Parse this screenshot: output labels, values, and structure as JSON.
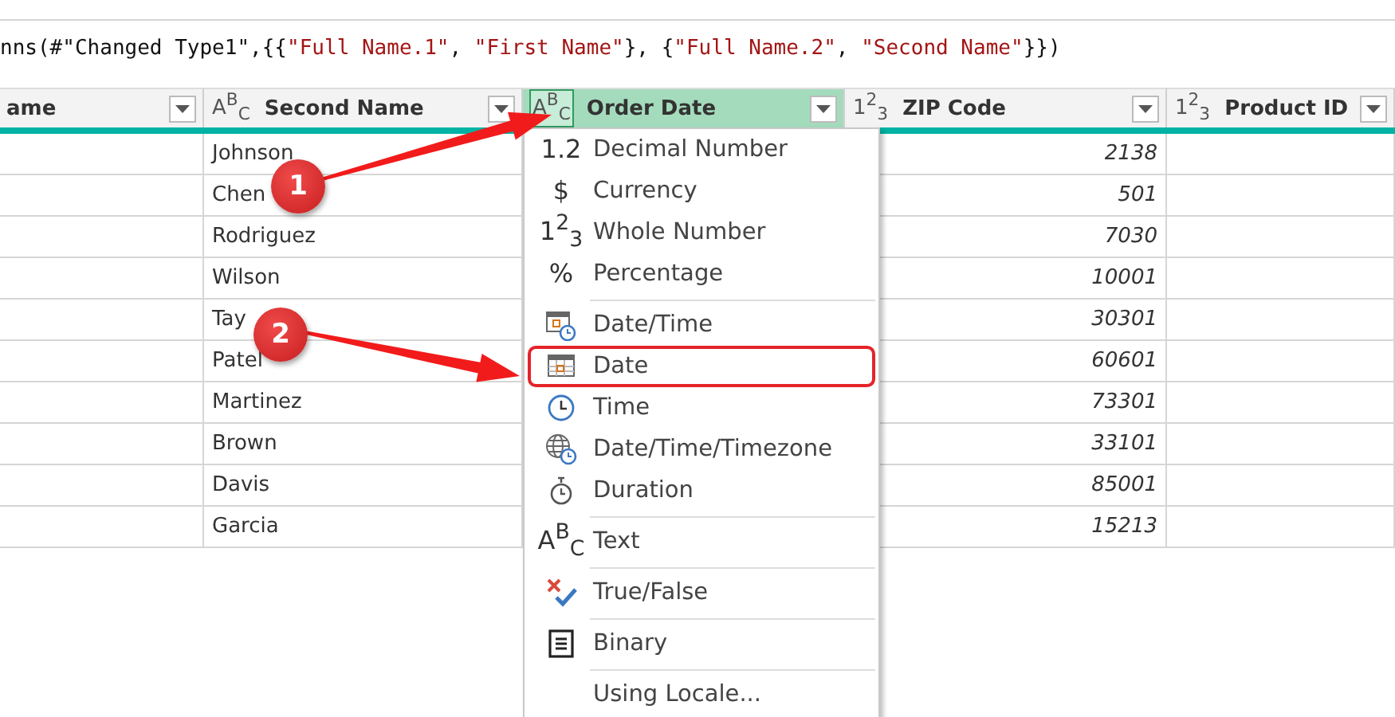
{
  "formula_bar": {
    "segments": [
      {
        "kind": "code",
        "text": "nns(#\"Changed Type1\",{{"
      },
      {
        "kind": "string",
        "text": "\"Full Name.1\""
      },
      {
        "kind": "code",
        "text": ", "
      },
      {
        "kind": "string",
        "text": "\"First Name\""
      },
      {
        "kind": "code",
        "text": "}, {"
      },
      {
        "kind": "string",
        "text": "\"Full Name.2\""
      },
      {
        "kind": "code",
        "text": ", "
      },
      {
        "kind": "string",
        "text": "\"Second Name\""
      },
      {
        "kind": "code",
        "text": "}})"
      }
    ]
  },
  "table": {
    "columns": [
      {
        "label": "ame",
        "selected": false
      },
      {
        "kind": "text",
        "type_icon": "A$^{B}$$_{C}$",
        "label": "Second Name",
        "selected": false
      },
      {
        "kind": "text",
        "type_icon": "A$^{B}$$_{C}$",
        "label": "Order Date",
        "selected": true
      },
      {
        "kind": "number",
        "type_icon": "1$^{2}$$_{3}$",
        "label": "ZIP Code",
        "selected": false
      },
      {
        "kind": "number",
        "type_icon": "1$^{2}$$_{3}$",
        "label": "Product ID",
        "selected": false
      }
    ],
    "rows": [
      {
        "second_name": "Johnson",
        "zip_code": "2138"
      },
      {
        "second_name": "Chen",
        "zip_code": "501"
      },
      {
        "second_name": "Rodriguez",
        "zip_code": "7030"
      },
      {
        "second_name": "Wilson",
        "zip_code": "10001"
      },
      {
        "second_name": "Tay",
        "zip_code": "30301"
      },
      {
        "second_name": "Patel",
        "zip_code": "60601"
      },
      {
        "second_name": "Martinez",
        "zip_code": "73301"
      },
      {
        "second_name": "Brown",
        "zip_code": "33101"
      },
      {
        "second_name": "Davis",
        "zip_code": "85001"
      },
      {
        "second_name": "Garcia",
        "zip_code": "15213"
      }
    ]
  },
  "type_menu": {
    "groups": [
      {
        "items": [
          {
            "kind": "glyph",
            "icon": "1.2",
            "label": "Decimal Number",
            "highlighted": false
          },
          {
            "kind": "glyph",
            "icon": "$",
            "label": "Currency",
            "highlighted": false
          },
          {
            "kind": "glyph",
            "icon": "1$^{2}$$_{3}$",
            "label": "Whole Number",
            "highlighted": false
          },
          {
            "kind": "glyph",
            "icon": "%",
            "label": "Percentage",
            "highlighted": false
          }
        ]
      },
      {
        "items": [
          {
            "kind": "datetime",
            "label": "Date/Time",
            "highlighted": false
          },
          {
            "kind": "date",
            "label": "Date",
            "highlighted": true
          },
          {
            "kind": "time",
            "label": "Time",
            "highlighted": false
          },
          {
            "kind": "timezone",
            "label": "Date/Time/Timezone",
            "highlighted": false
          },
          {
            "kind": "duration",
            "label": "Duration",
            "highlighted": false
          }
        ]
      },
      {
        "items": [
          {
            "kind": "glyph",
            "icon": "A$^{B}$$_{C}$",
            "label": "Text",
            "highlighted": false
          }
        ]
      },
      {
        "items": [
          {
            "kind": "truefalse",
            "label": "True/False",
            "highlighted": false
          }
        ]
      },
      {
        "items": [
          {
            "kind": "binary",
            "label": "Binary",
            "highlighted": false
          }
        ]
      },
      {
        "items": [
          {
            "kind": "none",
            "label": "Using Locale...",
            "highlighted": false
          }
        ]
      }
    ]
  },
  "annotations": [
    {
      "label": "1"
    },
    {
      "label": "2"
    }
  ]
}
